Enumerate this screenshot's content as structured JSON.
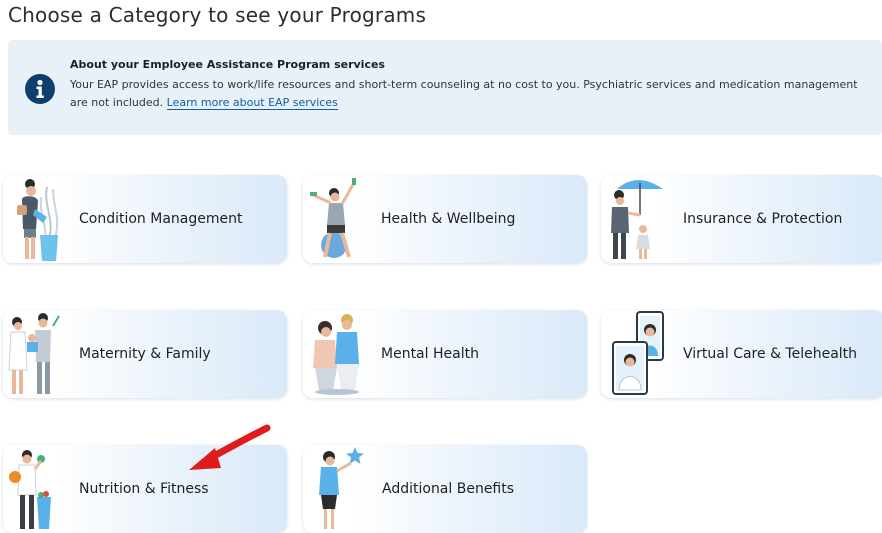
{
  "page": {
    "title": "Choose a Category to see your Programs"
  },
  "info_banner": {
    "icon": "info-icon",
    "title": "About your Employee Assistance Program services",
    "body": "Your EAP provides access to work/life resources and short-term counseling at no cost to you. Psychiatric services and medication management are not included.",
    "link_text": "Learn more about EAP services"
  },
  "categories": [
    {
      "label": "Condition Management",
      "icon": "woman-watering-plant-illustration"
    },
    {
      "label": "Health & Wellbeing",
      "icon": "woman-exercising-illustration"
    },
    {
      "label": "Insurance & Protection",
      "icon": "parent-child-umbrella-illustration"
    },
    {
      "label": "Maternity & Family",
      "icon": "family-illustration"
    },
    {
      "label": "Mental Health",
      "icon": "two-women-talking-illustration"
    },
    {
      "label": "Virtual Care & Telehealth",
      "icon": "video-call-illustration"
    },
    {
      "label": "Nutrition & Fitness",
      "icon": "person-with-groceries-illustration"
    },
    {
      "label": "Additional Benefits",
      "icon": "woman-holding-star-illustration"
    }
  ],
  "annotation": {
    "icon": "red-arrow-annotation",
    "color": "#e01b1b"
  },
  "colors": {
    "info_icon": "#0d3f6e",
    "link": "#0f5ea8",
    "banner_bg": "#e9f1f8"
  }
}
